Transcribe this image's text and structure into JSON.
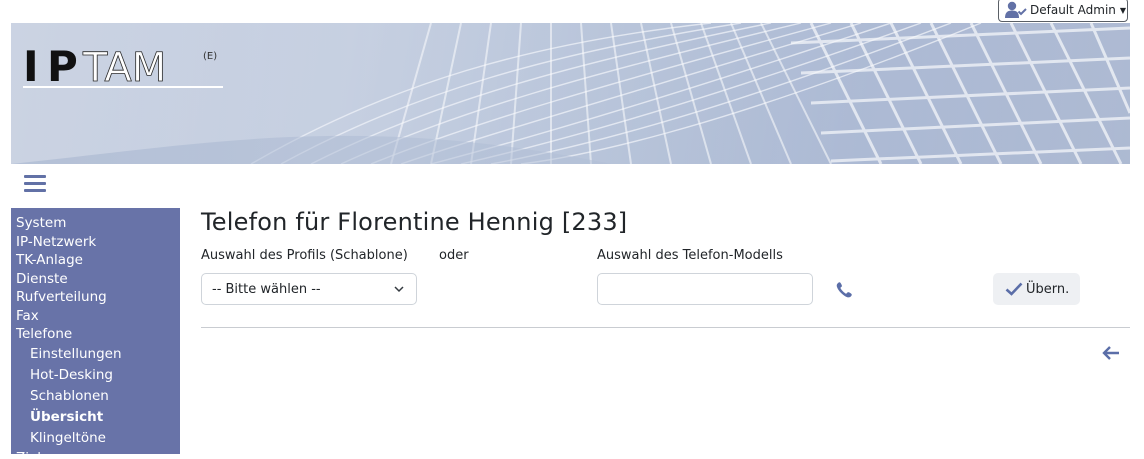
{
  "user_menu": {
    "label": "Default Admin",
    "icon": "user-check-icon"
  },
  "banner": {
    "logo_text": "IPTAM",
    "logo_mark": "(E)"
  },
  "sidebar": {
    "items": [
      {
        "label": "System"
      },
      {
        "label": "IP-Netzwerk"
      },
      {
        "label": "TK-Anlage"
      },
      {
        "label": "Dienste"
      },
      {
        "label": "Rufverteilung"
      },
      {
        "label": "Fax"
      },
      {
        "label": "Telefone"
      }
    ],
    "subitems": [
      {
        "label": "Einstellungen"
      },
      {
        "label": "Hot-Desking"
      },
      {
        "label": "Schablonen"
      },
      {
        "label": "Übersicht",
        "active": true
      },
      {
        "label": "Klingeltöne"
      }
    ],
    "cut_item": "Ziel"
  },
  "main": {
    "title": "Telefon für Florentine Hennig [233]",
    "profile_label": "Auswahl des Profils (Schablone)",
    "or_label": "oder",
    "model_label": "Auswahl des Telefon-Modells",
    "profile_select": {
      "value": "-- Bitte wählen --"
    },
    "model_input": {
      "value": ""
    },
    "apply_label": "Übern."
  },
  "colors": {
    "sidebar_bg": "#6873a8",
    "accent": "#6271a6",
    "icon_blue": "#5b6ea8"
  }
}
